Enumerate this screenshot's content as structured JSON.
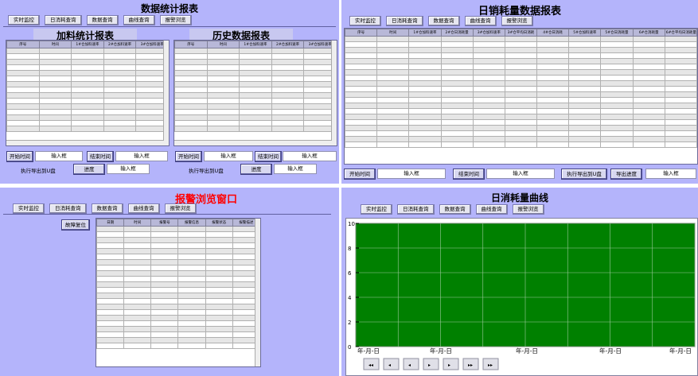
{
  "nav": [
    "实时监控",
    "日消耗查询",
    "数据查询",
    "曲线查询",
    "报警浏览"
  ],
  "q1": {
    "title": "数据统计报表",
    "left_title": "加料统计报表",
    "right_title": "历史数据报表",
    "left_cols": [
      "序号",
      "时间",
      "1#仓加料速率",
      "2#仓加料速率",
      "3#仓加料速率"
    ],
    "right_cols": [
      "序号",
      "时间",
      "1#仓加料速率",
      "2#仓加料速率",
      "3#仓加料速率"
    ],
    "start_label": "开始时间",
    "end_label": "结束时间",
    "input_label": "输入框",
    "export_label": "执行导出到U盘",
    "progress_label": "进度"
  },
  "q2": {
    "title": "日销耗量数据报表",
    "cols": [
      "序号",
      "时间",
      "1#仓加料速率",
      "2#仓日消耗量",
      "3#仓加料速率",
      "3#仓平均日消耗",
      "4#仓日消耗",
      "5#仓加料速率",
      "5#仓日消耗量",
      "6#仓消耗量",
      "6#仓平均日消耗量"
    ],
    "start_label": "开始时间",
    "end_label": "结束时间",
    "input_label": "输入框",
    "export_label": "执行导出到U盘",
    "progress_label": "导出进度"
  },
  "q3": {
    "title": "报警浏览窗口",
    "reset_label": "故障复位",
    "cols": [
      "日期",
      "时间",
      "报警号",
      "报警信息",
      "报警状态",
      "报警描述"
    ]
  },
  "q4": {
    "title": "日消耗量曲线",
    "nav_buttons": [
      "◂◂",
      "◂",
      "◂",
      "▸",
      "▸",
      "▸▸",
      "▸▸"
    ]
  },
  "chart_data": {
    "type": "line",
    "series": [],
    "y_ticks": [
      "10",
      "8",
      "6",
      "4",
      "2",
      "0"
    ],
    "x_ticks": [
      "年-月-日",
      "年-月-日",
      "年-月-日",
      "年-月-日",
      "年-月-日"
    ],
    "ylim": [
      0,
      10
    ],
    "grid": true,
    "background": "#008000"
  },
  "colors": {
    "panel": "#b4b4fb",
    "plot": "#008000",
    "title_red": "#ff0000"
  }
}
